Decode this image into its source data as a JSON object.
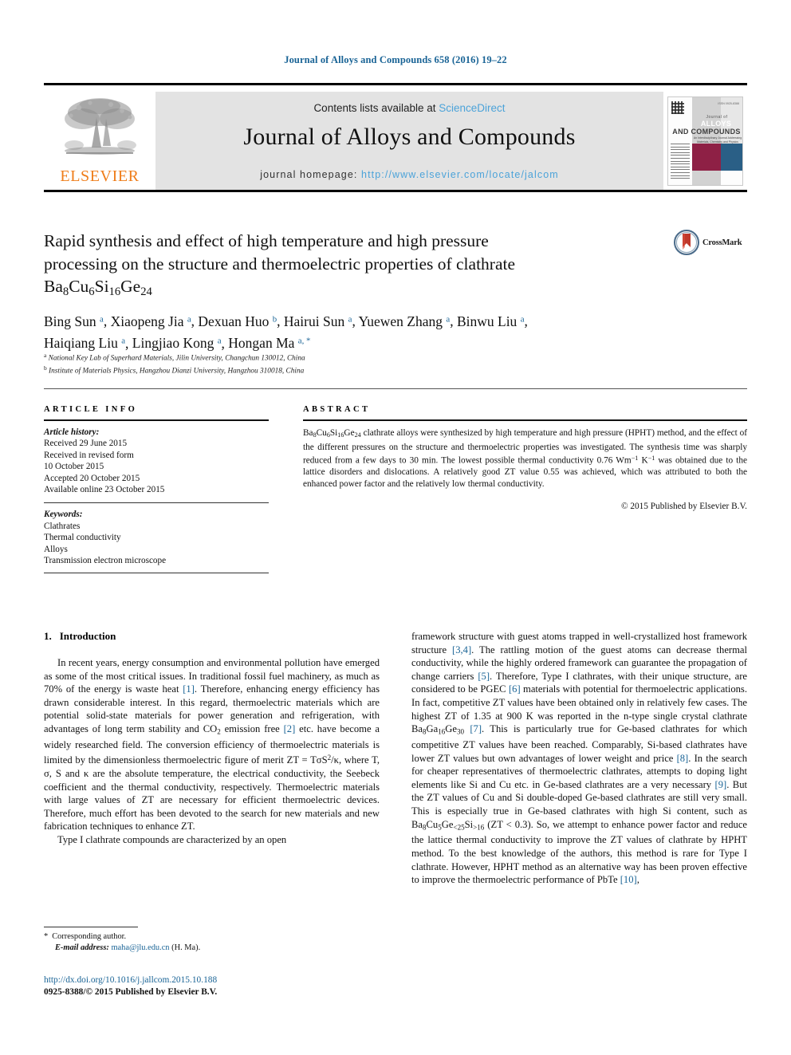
{
  "running_head": "Journal of Alloys and Compounds 658 (2016) 19–22",
  "masthead": {
    "contents_prefix": "Contents lists available at ",
    "sciencedirect": "ScienceDirect",
    "journal_title": "Journal of Alloys and Compounds",
    "homepage_prefix": "journal homepage: ",
    "homepage_url": "http://www.elsevier.com/locate/jalcom",
    "publisher_name": "ELSEVIER",
    "accent_link_color": "#4ca3d9",
    "elsevier_orange": "#ef7d1a",
    "band_color": "#e3e3e3"
  },
  "cover": {
    "line_small": "Journal of",
    "line_big": "ALLOYS",
    "line_big2": "AND COMPOUNDS",
    "subtitle": "An Interdisciplinary Journal Addressing\nMaterials, Chemistry and Physics",
    "issn_corner": "ISSN 0925-8388",
    "red": "#8e2045",
    "blue": "#2a5f86"
  },
  "article": {
    "title_line1": "Rapid synthesis and effect of high temperature and high pressure",
    "title_line2": "processing on the structure and thermoelectric properties of clathrate",
    "formula": {
      "Ba": "Ba",
      "Ba_sub": "8",
      "Cu": "Cu",
      "Cu_sub": "6",
      "Si": "Si",
      "Si_sub": "16",
      "Ge": "Ge",
      "Ge_sub": "24"
    },
    "crossmark_label": "CrossMark",
    "authors": [
      {
        "name": "Bing Sun",
        "sup": "a"
      },
      {
        "name": "Xiaopeng Jia",
        "sup": "a"
      },
      {
        "name": "Dexuan Huo",
        "sup": "b"
      },
      {
        "name": "Hairui Sun",
        "sup": "a"
      },
      {
        "name": "Yuewen Zhang",
        "sup": "a"
      },
      {
        "name": "Binwu Liu",
        "sup": "a"
      },
      {
        "name": "Haiqiang Liu",
        "sup": "a"
      },
      {
        "name": "Lingjiao Kong",
        "sup": "a"
      },
      {
        "name": "Hongan Ma",
        "sup": "a, *"
      }
    ],
    "affiliations": [
      {
        "marker": "a",
        "text": "National Key Lab of Superhard Materials, Jilin University, Changchun 130012, China"
      },
      {
        "marker": "b",
        "text": "Institute of Materials Physics, Hangzhou Dianzi University, Hangzhou 310018, China"
      }
    ]
  },
  "article_info": {
    "heading": "ARTICLE INFO",
    "history_label": "Article history:",
    "history": [
      "Received 29 June 2015",
      "Received in revised form",
      "10 October 2015",
      "Accepted 20 October 2015",
      "Available online 23 October 2015"
    ],
    "keywords_label": "Keywords:",
    "keywords": [
      "Clathrates",
      "Thermal conductivity",
      "Alloys",
      "Transmission electron microscope"
    ]
  },
  "abstract": {
    "heading": "ABSTRACT",
    "text_part1": " clathrate alloys were synthesized by high temperature and high pressure (HPHT) method, and the effect of the different pressures on the structure and thermoelectric properties was investigated. The synthesis time was sharply reduced from a few days to 30 min. The lowest possible thermal conductivity 0.76 Wm",
    "text_part2": " K",
    "text_part3": " was obtained due to the lattice disorders and dislocations. A relatively good ZT value 0.55 was achieved, which was attributed to both the enhanced power factor and the relatively low thermal conductivity.",
    "exp1": "−1",
    "exp2": "−1",
    "copyright": "© 2015 Published by Elsevier B.V."
  },
  "body": {
    "section_number": "1.",
    "section_title": "Introduction",
    "left_p1_a": "In recent years, energy consumption and environmental pollution have emerged as some of the most critical issues. In traditional fossil fuel machinery, as much as 70% of the energy is waste heat ",
    "left_p1_ref1": "[1]",
    "left_p1_b": ". Therefore, enhancing energy efficiency has drawn considerable interest. In this regard, thermoelectric materials which are potential solid-state materials for power generation and refrigeration, with advantages of long term stability and CO",
    "left_p1_co2sub": "2",
    "left_p1_c": " emission free ",
    "left_p1_ref2": "[2]",
    "left_p1_d": " etc. have become a widely researched field. The conversion efficiency of thermoelectric materials is limited by the dimensionless thermoelectric figure of merit ZT = TσS",
    "left_p1_sup": "2",
    "left_p1_e": "/κ, where T, σ, S and κ are the absolute temperature, the electrical conductivity, the Seebeck coefficient and the thermal conductivity, respectively. Thermoelectric materials with large values of ZT are necessary for efficient thermoelectric devices. Therefore, much effort has been devoted to the search for new materials and new fabrication techniques to enhance ZT.",
    "left_p2": "Type I clathrate compounds are characterized by an open",
    "right_p1_a": "framework structure with guest atoms trapped in well-crystallized host framework structure ",
    "right_ref34": "[3,4]",
    "right_p1_b": ". The rattling motion of the guest atoms can decrease thermal conductivity, while the highly ordered framework can guarantee the propagation of change carriers ",
    "right_ref5": "[5]",
    "right_p1_c": ". Therefore, Type I clathrates, with their unique structure, are considered to be PGEC ",
    "right_ref6": "[6]",
    "right_p1_d": " materials with potential for thermoelectric applications. In fact, competitive ZT values have been obtained only in relatively few cases. The highest ZT of 1.35 at 900 K was reported in the n-type single crystal clathrate Ba",
    "right_f1_sub": "8",
    "right_f1_mid": "Ga",
    "right_f2_sub": "16",
    "right_f2_mid": "Ge",
    "right_f3_sub": "30",
    "right_p1_e": " ",
    "right_ref7": "[7]",
    "right_p1_f": ". This is particularly true for Ge-based clathrates for which competitive ZT values have been reached. Comparably, Si-based clathrates have lower ZT values but own advantages of lower weight and price ",
    "right_ref8": "[8]",
    "right_p1_g": ". In the search for cheaper representatives of thermoelectric clathrates, attempts to doping light elements like Si and Cu etc. in Ge-based clathrates are a very necessary ",
    "right_ref9": "[9]",
    "right_p1_h": ". But the ZT values of Cu and Si double-doped Ge-based clathrates are still very small. This is especially true in Ge-based clathrates with high Si content, such as Ba",
    "right_f4_sub": "8",
    "right_f4_mid": "Cu",
    "right_f5_sub": "5",
    "right_f5_mid": "Ge",
    "right_f6_sub": "<25",
    "right_f6_mid": "Si",
    "right_f7_sub": ">16",
    "right_p1_i": " (ZT < 0.3). So, we attempt to enhance power factor and reduce the lattice thermal conductivity to improve the ZT values of clathrate by HPHT method. To the best knowledge of the authors, this method is rare for Type I clathrate. However, HPHT method as an alternative way has been proven effective to improve the thermoelectric performance of PbTe ",
    "right_ref10": "[10]",
    "right_p1_j": ","
  },
  "footer": {
    "corresponding_star": "*",
    "corresponding_author": "Corresponding author.",
    "email_label": "E-mail address:",
    "email": "maha@jlu.edu.cn",
    "email_suffix": "(H. Ma).",
    "doi": "http://dx.doi.org/10.1016/j.jallcom.2015.10.188",
    "issn_line": "0925-8388/© 2015 Published by Elsevier B.V."
  }
}
